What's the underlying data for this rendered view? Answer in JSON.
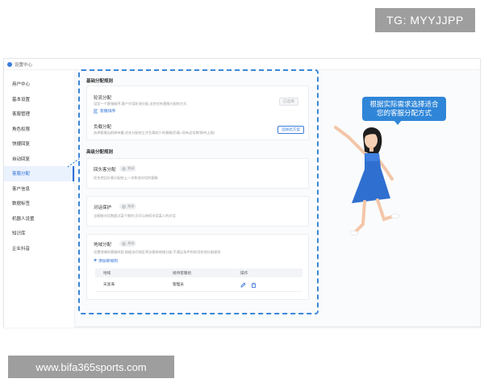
{
  "overlay": {
    "tg_label": "TG: MYYJJPP",
    "watermark": "www.bifa365sports.com"
  },
  "window": {
    "title": "设置中心"
  },
  "sidebar": {
    "items": [
      {
        "label": "用户中心",
        "active": false
      },
      {
        "label": "基本设置",
        "active": false
      },
      {
        "label": "客服管理",
        "active": false
      },
      {
        "label": "角色权限",
        "active": false
      },
      {
        "label": "快捷回复",
        "active": false
      },
      {
        "label": "自动回复",
        "active": false
      },
      {
        "label": "客服分配",
        "active": true
      },
      {
        "label": "客户信息",
        "active": false
      },
      {
        "label": "数据标签",
        "active": false
      },
      {
        "label": "机器人设置",
        "active": false
      },
      {
        "label": "知识库",
        "active": false
      },
      {
        "label": "企业抖音",
        "active": false
      }
    ]
  },
  "basic": {
    "heading": "基础分配规则",
    "polling": {
      "title": "轮流分配",
      "desc": "设定一个客服顺序,客户对话轮流分配,适合优先客服分配的方式",
      "button": "已选择",
      "link": "客服排序"
    },
    "load": {
      "title": "负载分配",
      "desc": "选择客服当前接待量,优先分配给工作负载较少的客服(负载=现有会话数/接待上限)",
      "button": "选择此方案"
    }
  },
  "advanced": {
    "heading": "高级分配规则",
    "recent": {
      "title": "回头客分配",
      "toggle": "关闭",
      "desc": "优先把回头客分配给上一次和他对话的客服"
    },
    "protect": {
      "title": "对话保护",
      "toggle": "关闭",
      "desc": "当客服对话数超过某个限时,仍可以继续对话某人的对话"
    },
    "region": {
      "title": "地域分配",
      "toggle": "关闭",
      "desc": "设置地域的客服阵容,根据访问地区将访客按地域分配,不满足条件则采用其他分配规则",
      "add_link": "添加新规则",
      "table": {
        "headers": [
          "地域",
          "接待客服组",
          "操作"
        ],
        "rows": [
          {
            "region": "天涯海",
            "group": "管理员"
          }
        ]
      }
    }
  },
  "callout": {
    "text": "根据实际需求选择适合您的客服分配方式"
  },
  "colors": {
    "accent": "#2f86d8",
    "dashed": "#3a86d9",
    "dress": "#2f6fd0"
  }
}
